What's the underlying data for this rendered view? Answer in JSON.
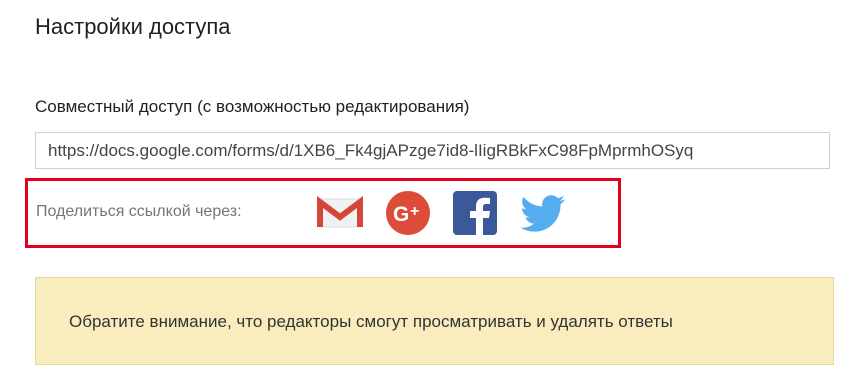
{
  "dialog": {
    "title": "Настройки доступа"
  },
  "link": {
    "label": "Совместный доступ (с возможностью редактирования)",
    "url": "https://docs.google.com/forms/d/1XB6_Fk4gjAPzge7id8-lIigRBkFxC98FpMprmhOSyq"
  },
  "share": {
    "label": "Поделиться ссылкой через:",
    "highlight_color": "#e3001b",
    "services": [
      {
        "name": "Gmail",
        "icon": "gmail-icon",
        "color": "#d44638"
      },
      {
        "name": "Google+",
        "icon": "google-plus-icon",
        "color": "#dd4b39"
      },
      {
        "name": "Facebook",
        "icon": "facebook-icon",
        "color": "#3b5998"
      },
      {
        "name": "Twitter",
        "icon": "twitter-icon",
        "color": "#55acee"
      }
    ]
  },
  "notice": {
    "text": "Обратите внимание, что редакторы смогут просматривать и удалять ответы",
    "background": "#f9edbe"
  }
}
